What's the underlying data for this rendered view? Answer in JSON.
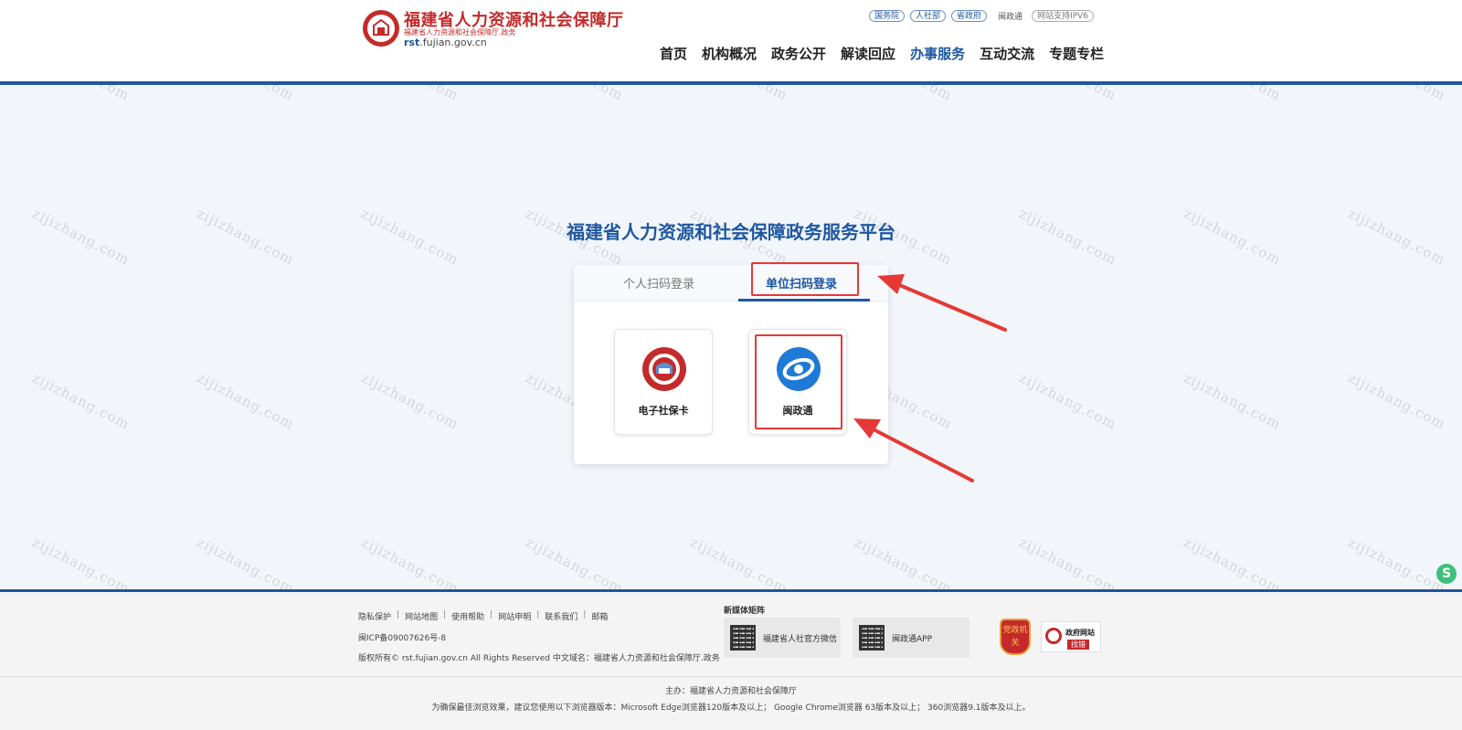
{
  "header": {
    "brand_main": "福建省人力资源和社会保障厅",
    "brand_sub": "福建省人力资源和社会保障厅.政务",
    "domain_prefix": "rst",
    "domain_suffix": ".fujian.gov.cn",
    "top_links": [
      "国务院",
      "人社部",
      "省政府"
    ],
    "top_plain_link": "闽政通",
    "ipv6_label": "网站支持IPV6",
    "nav": [
      "首页",
      "机构概况",
      "政务公开",
      "解读回应",
      "办事服务",
      "互动交流",
      "专题专栏"
    ],
    "nav_active": "办事服务"
  },
  "main": {
    "platform_title": "福建省人力资源和社会保障政务服务平台",
    "tabs": {
      "personal": "个人扫码登录",
      "unit": "单位扫码登录"
    },
    "active_tab": "unit",
    "apps": [
      {
        "label": "电子社保卡",
        "icon": "social-security-card-icon"
      },
      {
        "label": "闽政通",
        "icon": "minzhengtong-icon"
      }
    ]
  },
  "watermark": "zijizhang.com",
  "footer": {
    "links": [
      "隐私保护",
      "网站地图",
      "使用帮助",
      "网站申明",
      "联系我们",
      "邮箱"
    ],
    "icp": "闽ICP备09007626号-8",
    "copyright": "版权所有© rst.fujian.gov.cn All Rights Reserved   中文域名：福建省人力资源和社会保障厅.政务",
    "media_title": "新媒体矩阵",
    "media": [
      {
        "label": "福建省人社官方微信"
      },
      {
        "label": "闽政通APP"
      }
    ],
    "badge_party": "党政机关",
    "badge_error_line1": "政府网站",
    "badge_error_line2": "找错",
    "host": "主办：福建省人力资源和社会保障厅",
    "browser_note": "为确保最佳浏览效果，建议您使用以下浏览器版本：Microsoft Edge浏览器120版本及以上； Google Chrome浏览器 63版本及以上； 360浏览器9.1版本及以上。"
  },
  "colors": {
    "brand_red": "#c42a2a",
    "brand_blue": "#1e57a0",
    "highlight_red": "#e53935"
  }
}
